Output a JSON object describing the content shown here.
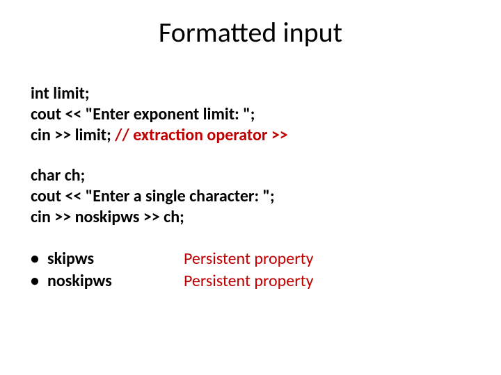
{
  "title": "Formatted input",
  "block1": {
    "line1": "int limit;",
    "line2": "cout << \"Enter exponent limit: \";",
    "line3_pre": "cin >> limit; ",
    "line3_red": "// extraction operator >>"
  },
  "block2": {
    "line1": "char ch;",
    "line2": "cout << \"Enter a single character: \";",
    "line3": "cin >> noskipws >> ch;"
  },
  "bullets": {
    "b1": "skipws",
    "b2": "noskipws",
    "p1": "Persistent property",
    "p2": "Persistent property"
  }
}
